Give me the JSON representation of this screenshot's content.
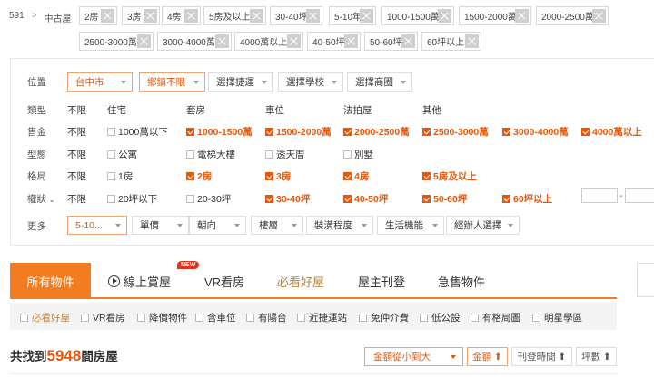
{
  "breadcrumb": {
    "root": "591",
    "separator": ">",
    "current": "中古屋"
  },
  "filter_tags": [
    "2房",
    "3房",
    "4房",
    "5房及以上",
    "30-40坪",
    "5-10年",
    "1000-1500萬",
    "1500-2000萬",
    "2000-2500萬",
    "2500-3000萬",
    "3000-4000萬",
    "4000萬以上",
    "40-50坪",
    "50-60坪",
    "60坪以上"
  ],
  "location": {
    "label": "位置",
    "city": "台中市",
    "district": "鄉鎮不限",
    "mrt": "選擇捷運",
    "school": "選擇學校",
    "shop": "選擇商圈"
  },
  "type_row": {
    "label": "類型",
    "all": "不限",
    "options": [
      "住宅",
      "套房",
      "車位",
      "法拍屋",
      "其他"
    ]
  },
  "price_row": {
    "label": "售金",
    "all": "不限",
    "options": [
      {
        "label": "1000萬以下",
        "checked": false
      },
      {
        "label": "1000-1500萬",
        "checked": true
      },
      {
        "label": "1500-2000萬",
        "checked": true
      },
      {
        "label": "2000-2500萬",
        "checked": true
      },
      {
        "label": "2500-3000萬",
        "checked": true
      },
      {
        "label": "3000-4000萬",
        "checked": true
      },
      {
        "label": "4000萬以上",
        "checked": true
      }
    ]
  },
  "form_row": {
    "label": "型態",
    "all": "不限",
    "options": [
      {
        "label": "公寓",
        "checked": false
      },
      {
        "label": "電梯大樓",
        "checked": false
      },
      {
        "label": "透天厝",
        "checked": false
      },
      {
        "label": "別墅",
        "checked": false
      }
    ]
  },
  "layout_row": {
    "label": "格局",
    "all": "不限",
    "options": [
      {
        "label": "1房",
        "checked": false
      },
      {
        "label": "2房",
        "checked": true
      },
      {
        "label": "3房",
        "checked": true
      },
      {
        "label": "4房",
        "checked": true
      },
      {
        "label": "5房及以上",
        "checked": true
      }
    ]
  },
  "size_row": {
    "label": "權狀",
    "all": "不限",
    "range_dash": "-",
    "options": [
      {
        "label": "20坪以下",
        "checked": false
      },
      {
        "label": "20-30坪",
        "checked": false
      },
      {
        "label": "30-40坪",
        "checked": true
      },
      {
        "label": "40-50坪",
        "checked": true
      },
      {
        "label": "50-60坪",
        "checked": true
      },
      {
        "label": "60坪以上",
        "checked": true
      }
    ]
  },
  "more_row": {
    "label": "更多",
    "age": "5-10...",
    "unit_price": "單價",
    "direction": "朝向",
    "floor": "樓層",
    "decoration": "裝潢程度",
    "life": "生活機能",
    "agent": "經辦人選擇"
  },
  "tabs": {
    "all": "所有物件",
    "online": "線上賞屋",
    "new_badge": "NEW",
    "vr": "VR看房",
    "must": "必看好屋",
    "owner": "屋主刊登",
    "urgent": "急售物件"
  },
  "quick_filters": [
    "必看好屋",
    "VR看房",
    "降價物件",
    "含車位",
    "有陽台",
    "近捷運站",
    "免仲介費",
    "低公設",
    "有格局圖",
    "明星學區"
  ],
  "result": {
    "prefix": "共找到",
    "count": "5948",
    "suffix": "間房屋"
  },
  "sort": {
    "amount_select": "金額從小到大",
    "amount": "金額 ⬆",
    "post_time": "刊登時間 ⬆",
    "area": "坪數 ⬆"
  },
  "colors": {
    "accent": "#f27c1f",
    "checked_text": "#e4570c",
    "gold": "#b5833f",
    "badge": "#e0341d"
  }
}
